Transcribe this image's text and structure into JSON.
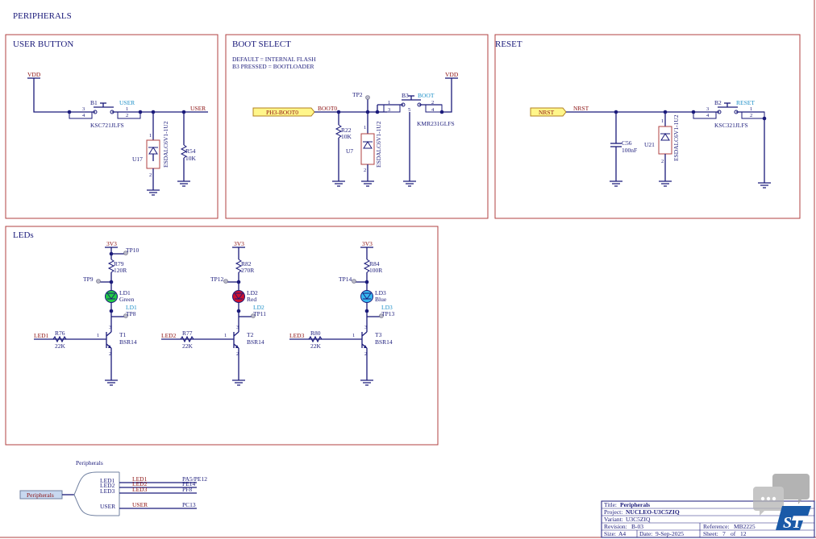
{
  "sheet_title": "PERIPHERALS",
  "user_button": {
    "title": "USER BUTTON",
    "vdd": "VDD",
    "switch_ref": "B1",
    "switch_label": "USER",
    "switch_part": "KSC721JLFS",
    "pin3": "3",
    "pin4": "4",
    "pin1": "1",
    "pin2": "2",
    "net": "USER",
    "tvs_ref": "U17",
    "tvs_part": "ESDALC6V1-1U2",
    "tvs_pin1": "1",
    "tvs_pin2": "2",
    "res_ref": "R54",
    "res_val": "10K"
  },
  "boot_select": {
    "title": "BOOT SELECT",
    "note1": "DEFAULT = INTERNAL FLASH",
    "note2": "B3 PRESSED = BOOTLOADER",
    "port": "PH3-BOOT0",
    "net": "BOOT0",
    "tp": "TP2",
    "res_ref": "R22",
    "res_val": "10K",
    "tvs_ref": "U7",
    "tvs_part": "ESDALC6V1-1U2",
    "tvs_pin1": "1",
    "tvs_pin2": "2",
    "switch_ref": "B3",
    "switch_label": "BOOT",
    "switch_part": "KMR231GLFS",
    "pin1": "1",
    "pin2": "2",
    "pin3": "3",
    "pin4": "4",
    "pin5": "5",
    "vdd": "VDD"
  },
  "reset": {
    "title": "RESET",
    "port": "NRST",
    "net": "NRST",
    "cap_ref": "C56",
    "cap_val": "100nF",
    "tvs_ref": "U21",
    "tvs_part": "ESDALC6V1-1U2",
    "tvs_pin1": "1",
    "tvs_pin2": "2",
    "switch_ref": "B2",
    "switch_label": "RESET",
    "switch_part": "KSC321JLFS",
    "pin3": "3",
    "pin4": "4",
    "pin1": "1",
    "pin2": "2"
  },
  "leds": {
    "title": "LEDs",
    "channels": [
      {
        "supply": "3V3",
        "res_ref": "R79",
        "res_val": "120R",
        "tp_top": "TP10",
        "tp_left": "TP9",
        "led_ref": "LD1",
        "led_color": "Green",
        "net_cyan": "LD1",
        "tp_node": "TP8",
        "net_in": "LED1",
        "base_res": "R76",
        "base_val": "22K",
        "tr_ref": "T1",
        "tr_part": "BSR14",
        "pin1": "1",
        "pin2": "2",
        "pin3": "3",
        "color": "#22cc44"
      },
      {
        "supply": "3V3",
        "res_ref": "R82",
        "res_val": "270R",
        "tp_top": "",
        "tp_left": "TP12",
        "led_ref": "LD2",
        "led_color": "Red",
        "net_cyan": "LD2",
        "tp_node": "TP11",
        "net_in": "LED2",
        "base_res": "R77",
        "base_val": "22K",
        "tr_ref": "T2",
        "tr_part": "BSR14",
        "pin1": "1",
        "pin2": "2",
        "pin3": "3",
        "color": "#cc1030"
      },
      {
        "supply": "3V3",
        "res_ref": "R84",
        "res_val": "100R",
        "tp_top": "",
        "tp_left": "TP14",
        "led_ref": "LD3",
        "led_color": "Blue",
        "net_cyan": "LD3",
        "tp_node": "TP13",
        "net_in": "LED3",
        "base_res": "R80",
        "base_val": "22K",
        "tr_ref": "T3",
        "tr_part": "BSR14",
        "pin1": "1",
        "pin2": "2",
        "pin3": "3",
        "color": "#38b8f0"
      }
    ]
  },
  "harness": {
    "title": "Peripherals",
    "port": "Peripherals",
    "rows": [
      {
        "pin": "LED1",
        "net": "LED1",
        "signal": "PA5/PE12"
      },
      {
        "pin": "LED2",
        "net": "LED2",
        "signal": "PE14"
      },
      {
        "pin": "LED3",
        "net": "LED3",
        "signal": "PF8"
      },
      {
        "pin": "USER",
        "net": "USER",
        "signal": "PC13"
      }
    ]
  },
  "title_block": {
    "title_label": "Title:",
    "title": "Peripherals",
    "project_label": "Project:",
    "project": "NUCLEO-U3C5ZIQ",
    "variant_label": "Variant:",
    "variant": "U3C5ZIQ",
    "revision_label": "Revision:",
    "revision": "B-03",
    "reference_label": "Reference:",
    "reference": "MB2225",
    "size_label": "Size:",
    "size": "A4",
    "date_label": "Date:",
    "date": "9-Sep-2025",
    "sheet_label": "Sheet:",
    "sheet": "7",
    "of_label": "of",
    "sheet_total": "12",
    "logo": "ST"
  }
}
